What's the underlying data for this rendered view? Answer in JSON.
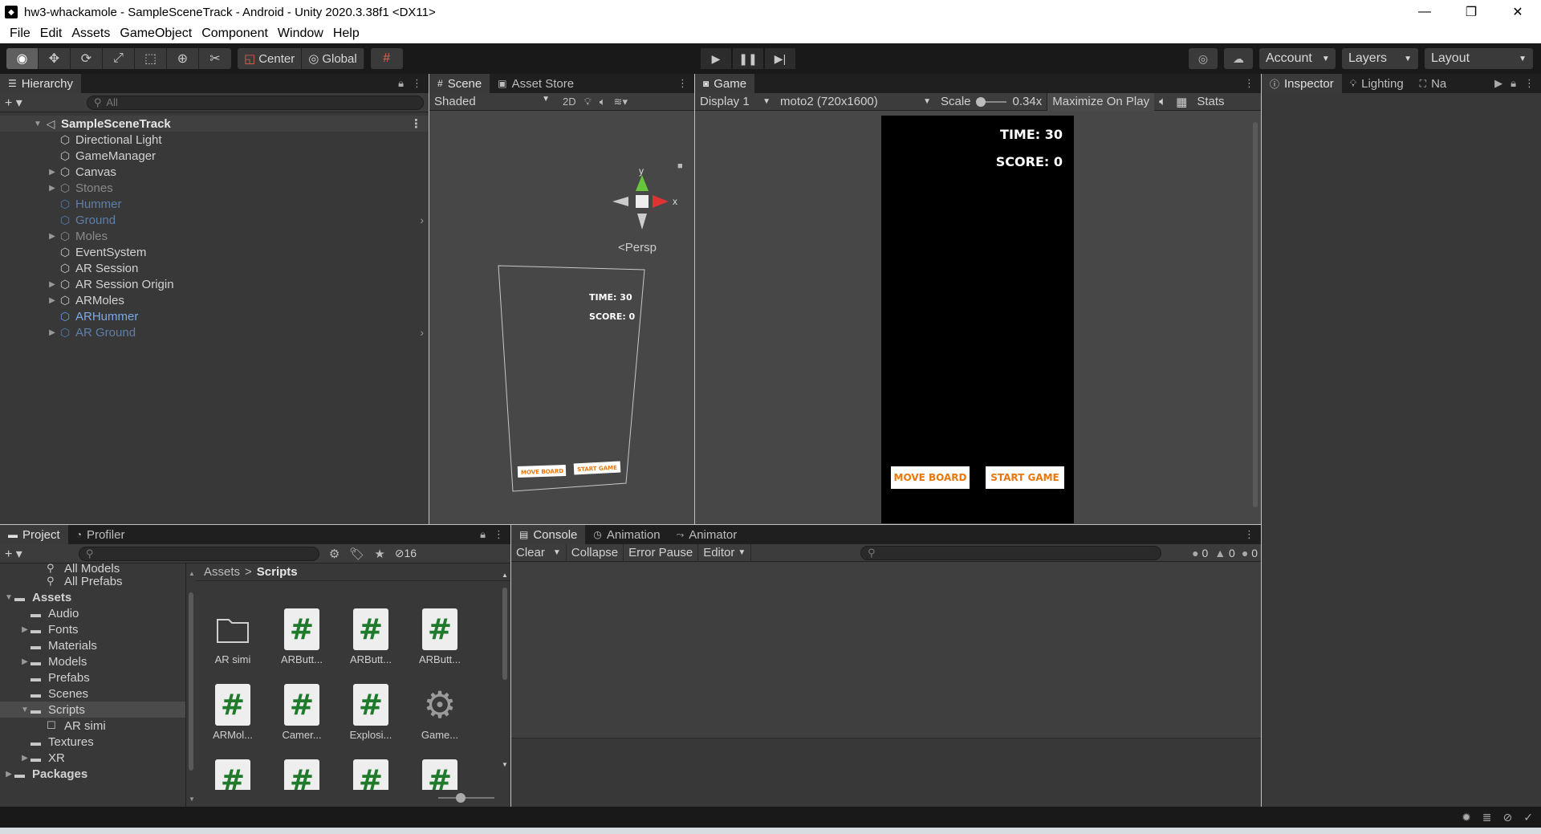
{
  "window": {
    "title": "hw3-whackamole - SampleSceneTrack - Android - Unity 2020.3.38f1 <DX11>"
  },
  "menu": [
    "File",
    "Edit",
    "Assets",
    "GameObject",
    "Component",
    "Window",
    "Help"
  ],
  "toolbar": {
    "pivot": "Center",
    "space": "Global",
    "account": "Account",
    "layers": "Layers",
    "layout": "Layout"
  },
  "hierarchy": {
    "tab": "Hierarchy",
    "search_placeholder": "All",
    "root": "SampleSceneTrack",
    "items": [
      {
        "label": "Directional Light",
        "style": "normal",
        "expandable": false
      },
      {
        "label": "GameManager",
        "style": "normal",
        "expandable": false
      },
      {
        "label": "Canvas",
        "style": "normal",
        "expandable": true
      },
      {
        "label": "Stones",
        "style": "dim",
        "expandable": true
      },
      {
        "label": "Hummer",
        "style": "prefab-dim",
        "expandable": false
      },
      {
        "label": "Ground",
        "style": "prefab-dim",
        "expandable": false
      },
      {
        "label": "Moles",
        "style": "dim",
        "expandable": true
      },
      {
        "label": "EventSystem",
        "style": "normal",
        "expandable": false
      },
      {
        "label": "AR Session",
        "style": "normal",
        "expandable": false
      },
      {
        "label": "AR Session Origin",
        "style": "normal",
        "expandable": true
      },
      {
        "label": "ARMoles",
        "style": "normal",
        "expandable": true
      },
      {
        "label": "ARHummer",
        "style": "prefab",
        "expandable": false
      },
      {
        "label": "AR Ground",
        "style": "prefab-dim",
        "expandable": true
      }
    ]
  },
  "scene": {
    "tabs": [
      "Scene",
      "Asset Store"
    ],
    "shading": "Shaded",
    "mode_2d": "2D",
    "gizmo_y": "y",
    "gizmo_x": "x",
    "persp": "Persp",
    "time_text": "TIME: 30",
    "score_text": "SCORE: 0",
    "move_board": "MOVE BOARD",
    "start_game": "START GAME"
  },
  "game": {
    "tab": "Game",
    "display": "Display 1",
    "resolution": "moto2 (720x1600)",
    "scale_label": "Scale",
    "scale_value": "0.34x",
    "maximize": "Maximize On Play",
    "stats": "Stats",
    "time_text": "TIME: 30",
    "score_text": "SCORE: 0",
    "move_board": "MOVE BOARD",
    "start_game": "START GAME"
  },
  "inspector": {
    "tabs": [
      "Inspector",
      "Lighting",
      "Na"
    ]
  },
  "project": {
    "tabs": [
      "Project",
      "Profiler"
    ],
    "hidden_count": "16",
    "tree": [
      {
        "label": "All Models",
        "indent": 2,
        "icon": "search",
        "bold": false
      },
      {
        "label": "All Prefabs",
        "indent": 2,
        "icon": "search",
        "bold": false
      },
      {
        "label": "Assets",
        "indent": 0,
        "icon": "folder",
        "bold": true,
        "open": true
      },
      {
        "label": "Audio",
        "indent": 1,
        "icon": "folder",
        "bold": false
      },
      {
        "label": "Fonts",
        "indent": 1,
        "icon": "folder",
        "bold": false,
        "expandable": true
      },
      {
        "label": "Materials",
        "indent": 1,
        "icon": "folder",
        "bold": false
      },
      {
        "label": "Models",
        "indent": 1,
        "icon": "folder",
        "bold": false,
        "expandable": true
      },
      {
        "label": "Prefabs",
        "indent": 1,
        "icon": "folder",
        "bold": false
      },
      {
        "label": "Scenes",
        "indent": 1,
        "icon": "folder",
        "bold": false
      },
      {
        "label": "Scripts",
        "indent": 1,
        "icon": "folder-open",
        "bold": false,
        "selected": true,
        "open": true
      },
      {
        "label": "AR simi",
        "indent": 2,
        "icon": "folder-empty",
        "bold": false
      },
      {
        "label": "Textures",
        "indent": 1,
        "icon": "folder",
        "bold": false
      },
      {
        "label": "XR",
        "indent": 1,
        "icon": "folder",
        "bold": false,
        "expandable": true
      },
      {
        "label": "Packages",
        "indent": 0,
        "icon": "folder",
        "bold": true,
        "expandable": true
      }
    ],
    "breadcrumb": [
      "Assets",
      "Scripts"
    ],
    "files": [
      {
        "label": "AR simi",
        "kind": "folder"
      },
      {
        "label": "ARButt...",
        "kind": "script"
      },
      {
        "label": "ARButt...",
        "kind": "script"
      },
      {
        "label": "ARButt...",
        "kind": "script"
      },
      {
        "label": "ARMol...",
        "kind": "script"
      },
      {
        "label": "Camer...",
        "kind": "script"
      },
      {
        "label": "Explosi...",
        "kind": "script"
      },
      {
        "label": "Game...",
        "kind": "gear"
      },
      {
        "label": "",
        "kind": "script"
      },
      {
        "label": "",
        "kind": "script"
      },
      {
        "label": "",
        "kind": "script"
      },
      {
        "label": "",
        "kind": "script"
      }
    ]
  },
  "console": {
    "tabs": [
      "Console",
      "Animation",
      "Animator"
    ],
    "clear": "Clear",
    "collapse": "Collapse",
    "error_pause": "Error Pause",
    "editor": "Editor",
    "log_count": "0",
    "warn_count": "0",
    "error_count": "0"
  }
}
